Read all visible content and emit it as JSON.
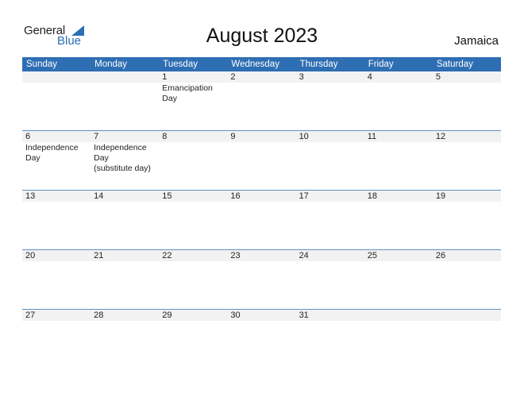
{
  "logo": {
    "word1": "General",
    "word2": "Blue"
  },
  "title": "August 2023",
  "country": "Jamaica",
  "weekdays": [
    "Sunday",
    "Monday",
    "Tuesday",
    "Wednesday",
    "Thursday",
    "Friday",
    "Saturday"
  ],
  "weeks": [
    {
      "days": [
        "",
        "",
        "1",
        "2",
        "3",
        "4",
        "5"
      ],
      "events": [
        "",
        "",
        "Emancipation Day",
        "",
        "",
        "",
        ""
      ]
    },
    {
      "days": [
        "6",
        "7",
        "8",
        "9",
        "10",
        "11",
        "12"
      ],
      "events": [
        "Independence Day",
        "Independence Day\n(substitute day)",
        "",
        "",
        "",
        "",
        ""
      ]
    },
    {
      "days": [
        "13",
        "14",
        "15",
        "16",
        "17",
        "18",
        "19"
      ],
      "events": [
        "",
        "",
        "",
        "",
        "",
        "",
        ""
      ]
    },
    {
      "days": [
        "20",
        "21",
        "22",
        "23",
        "24",
        "25",
        "26"
      ],
      "events": [
        "",
        "",
        "",
        "",
        "",
        "",
        ""
      ]
    },
    {
      "days": [
        "27",
        "28",
        "29",
        "30",
        "31",
        "",
        ""
      ],
      "events": [
        "",
        "",
        "",
        "",
        "",
        "",
        ""
      ]
    }
  ],
  "colors": {
    "header": "#2e6eb3",
    "brand": "#2a6fb5",
    "strip": "#f2f2f2",
    "rule": "#5f93c8"
  }
}
